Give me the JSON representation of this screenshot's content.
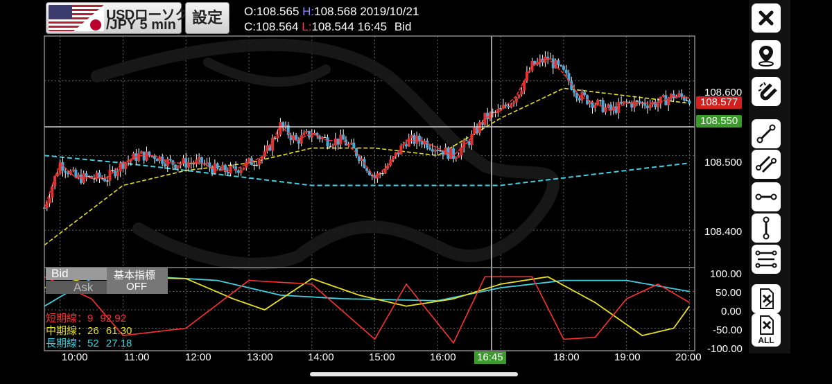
{
  "header": {
    "pair_top": "USDローソク",
    "pair_bottom": "/JPY 5 min",
    "settings_label": "設定",
    "open_label": "O:",
    "open_value": "108.565",
    "high_label": "H:",
    "high_value": "108.568",
    "date": "2019/10/21",
    "close_label": "C:",
    "close_value": "108.564",
    "low_label": "L:",
    "low_value": "108.544",
    "time": "16:45",
    "side": "Bid"
  },
  "price_axis": {
    "ticks": [
      "108.600",
      "108.500",
      "108.400"
    ],
    "current_bid_tag": "108.577",
    "crosshair_tag": "108.550"
  },
  "osc_axis": {
    "ticks": [
      "100.00",
      "50.00",
      "0.00",
      "-50.00",
      "-100.00"
    ]
  },
  "time_axis": {
    "ticks": [
      "10:00",
      "11:00",
      "12:00",
      "13:00",
      "14:00",
      "15:00",
      "16:00",
      "17:00",
      "18:00",
      "19:00",
      "20:00"
    ],
    "crosshair_time": "16:45"
  },
  "indicator_panel": {
    "bid_label": "Bid",
    "ask_label": "Ask",
    "indicator_title": "基本指標",
    "indicator_state": "OFF",
    "short_line": "短期線：9",
    "short_value": "92.92",
    "mid_line": "中期線：26",
    "mid_value": "61.30",
    "long_line": "長期線：52",
    "long_value": "27.18"
  },
  "toolbar": {
    "icons": [
      "close-icon",
      "location-pin-icon",
      "magnet-icon",
      "trend-line-icon",
      "channel-line-icon",
      "horizontal-line-icon",
      "vertical-line-icon",
      "fibonacci-lines-icon",
      "delete-drawing-icon",
      "delete-all-drawings-icon"
    ],
    "delete_all_label": "ALL"
  },
  "colors": {
    "up_candle": "#e03030",
    "down_candle": "#4aa8d8",
    "doji": "#ffffff",
    "short_ma": "#ff3030",
    "mid_ma": "#e8e020",
    "long_ma": "#40d0e0",
    "grid": "#666666"
  },
  "chart_data": {
    "type": "candlestick",
    "symbol": "USD/JPY",
    "interval": "5 min",
    "date": "2019/10/21",
    "price_range": [
      108.35,
      108.66
    ],
    "x_ticks": [
      "10:00",
      "11:00",
      "12:00",
      "13:00",
      "14:00",
      "15:00",
      "16:00",
      "17:00",
      "18:00",
      "19:00",
      "20:00"
    ],
    "close_path": [
      [
        "09:45",
        108.43
      ],
      [
        "10:00",
        108.49
      ],
      [
        "10:15",
        108.47
      ],
      [
        "10:30",
        108.47
      ],
      [
        "10:45",
        108.47
      ],
      [
        "11:00",
        108.49
      ],
      [
        "11:15",
        108.5
      ],
      [
        "11:30",
        108.5
      ],
      [
        "11:45",
        108.49
      ],
      [
        "12:00",
        108.49
      ],
      [
        "12:15",
        108.49
      ],
      [
        "12:30",
        108.48
      ],
      [
        "12:45",
        108.48
      ],
      [
        "13:00",
        108.49
      ],
      [
        "13:15",
        108.5
      ],
      [
        "13:30",
        108.54
      ],
      [
        "13:45",
        108.52
      ],
      [
        "14:00",
        108.53
      ],
      [
        "14:15",
        108.52
      ],
      [
        "14:30",
        108.52
      ],
      [
        "14:45",
        108.5
      ],
      [
        "15:00",
        108.47
      ],
      [
        "15:15",
        108.49
      ],
      [
        "15:30",
        108.52
      ],
      [
        "15:45",
        108.52
      ],
      [
        "16:00",
        108.51
      ],
      [
        "16:15",
        108.5
      ],
      [
        "16:30",
        108.52
      ],
      [
        "16:45",
        108.55
      ],
      [
        "17:00",
        108.56
      ],
      [
        "17:15",
        108.58
      ],
      [
        "17:30",
        108.62
      ],
      [
        "17:45",
        108.63
      ],
      [
        "18:00",
        108.61
      ],
      [
        "18:15",
        108.58
      ],
      [
        "18:30",
        108.57
      ],
      [
        "18:45",
        108.56
      ],
      [
        "19:00",
        108.57
      ],
      [
        "19:15",
        108.57
      ],
      [
        "19:30",
        108.57
      ],
      [
        "19:45",
        108.58
      ],
      [
        "20:00",
        108.577
      ]
    ],
    "mid_ma_path": [
      [
        "09:45",
        108.38
      ],
      [
        "11:00",
        108.46
      ],
      [
        "12:00",
        108.48
      ],
      [
        "13:00",
        108.49
      ],
      [
        "14:00",
        108.51
      ],
      [
        "15:00",
        108.51
      ],
      [
        "16:00",
        108.5
      ],
      [
        "17:00",
        108.55
      ],
      [
        "18:00",
        108.59
      ],
      [
        "19:00",
        108.58
      ],
      [
        "20:00",
        108.57
      ]
    ],
    "long_ma_path": [
      [
        "09:45",
        108.5
      ],
      [
        "11:00",
        108.49
      ],
      [
        "12:00",
        108.48
      ],
      [
        "13:00",
        108.47
      ],
      [
        "14:00",
        108.46
      ],
      [
        "15:00",
        108.46
      ],
      [
        "16:00",
        108.46
      ],
      [
        "17:00",
        108.46
      ],
      [
        "18:00",
        108.47
      ],
      [
        "19:00",
        108.48
      ],
      [
        "20:00",
        108.49
      ]
    ],
    "oscillator": {
      "range": [
        -100,
        100
      ],
      "short": [
        [
          "09:45",
          90
        ],
        [
          "10:30",
          30
        ],
        [
          "11:00",
          -70
        ],
        [
          "12:00",
          -50
        ],
        [
          "13:00",
          80
        ],
        [
          "14:00",
          70
        ],
        [
          "15:00",
          -80
        ],
        [
          "15:30",
          70
        ],
        [
          "16:15",
          -90
        ],
        [
          "16:45",
          90
        ],
        [
          "17:30",
          90
        ],
        [
          "18:00",
          -80
        ],
        [
          "18:30",
          -75
        ],
        [
          "19:00",
          30
        ],
        [
          "19:30",
          70
        ],
        [
          "20:00",
          20
        ]
      ],
      "mid": [
        [
          "09:45",
          60
        ],
        [
          "10:30",
          90
        ],
        [
          "12:00",
          85
        ],
        [
          "12:45",
          30
        ],
        [
          "13:15",
          0
        ],
        [
          "14:00",
          85
        ],
        [
          "14:45",
          40
        ],
        [
          "15:30",
          10
        ],
        [
          "16:15",
          30
        ],
        [
          "17:00",
          70
        ],
        [
          "17:45",
          90
        ],
        [
          "18:30",
          20
        ],
        [
          "19:15",
          -70
        ],
        [
          "19:45",
          -50
        ],
        [
          "20:00",
          10
        ]
      ],
      "long": [
        [
          "09:45",
          10
        ],
        [
          "10:30",
          85
        ],
        [
          "11:30",
          90
        ],
        [
          "12:30",
          80
        ],
        [
          "13:30",
          40
        ],
        [
          "14:30",
          30
        ],
        [
          "16:00",
          25
        ],
        [
          "17:00",
          60
        ],
        [
          "18:00",
          80
        ],
        [
          "19:00",
          80
        ],
        [
          "20:00",
          50
        ]
      ]
    }
  }
}
